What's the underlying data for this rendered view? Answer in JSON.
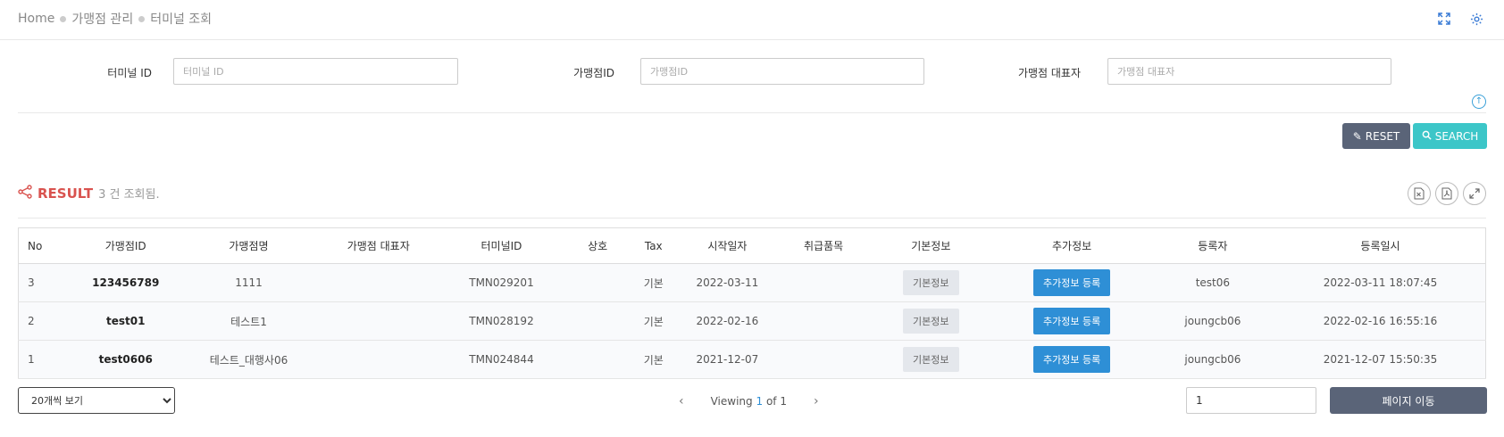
{
  "breadcrumb": [
    "Home",
    "가맹점 관리",
    "터미널 조회"
  ],
  "top_icons": [
    "fullscreen-icon",
    "gear-icon"
  ],
  "search": {
    "terminal_id": {
      "label": "터미널 ID",
      "placeholder": "터미널 ID",
      "value": ""
    },
    "merchant_id": {
      "label": "가맹점ID",
      "placeholder": "가맹점ID",
      "value": ""
    },
    "representative": {
      "label": "가맹점 대표자",
      "placeholder": "가맹점 대표자",
      "value": ""
    }
  },
  "buttons": {
    "reset": "RESET",
    "search": "SEARCH"
  },
  "result": {
    "title": "RESULT",
    "count_text": "3 건 조회됨."
  },
  "result_tools": [
    "excel-icon",
    "pdf-icon",
    "expand-icon"
  ],
  "table": {
    "headers": [
      "No",
      "가맹점ID",
      "가맹점명",
      "가맹점 대표자",
      "터미널ID",
      "상호",
      "Tax",
      "시작일자",
      "취급품목",
      "기본정보",
      "추가정보",
      "등록자",
      "등록일시"
    ],
    "rows": [
      {
        "no": "3",
        "merchant_id": "123456789",
        "merchant_name": "1111",
        "representative": "",
        "terminal_id": "TMN029201",
        "company": "",
        "tax": "기본",
        "start_date": "2022-03-11",
        "items": "",
        "basic_info": "기본정보",
        "extra_info": "추가정보 등록",
        "registrant": "test06",
        "registered_at": "2022-03-11 18:07:45"
      },
      {
        "no": "2",
        "merchant_id": "test01",
        "merchant_name": "테스트1",
        "representative": "",
        "terminal_id": "TMN028192",
        "company": "",
        "tax": "기본",
        "start_date": "2022-02-16",
        "items": "",
        "basic_info": "기본정보",
        "extra_info": "추가정보 등록",
        "registrant": "joungcb06",
        "registered_at": "2022-02-16 16:55:16"
      },
      {
        "no": "1",
        "merchant_id": "test0606",
        "merchant_name": "테스트_대행사06",
        "representative": "",
        "terminal_id": "TMN024844",
        "company": "",
        "tax": "기본",
        "start_date": "2021-12-07",
        "items": "",
        "basic_info": "기본정보",
        "extra_info": "추가정보 등록",
        "registrant": "joungcb06",
        "registered_at": "2021-12-07 15:50:35"
      }
    ]
  },
  "pagination": {
    "page_size_option": "20개씩 보기",
    "viewing_prefix": "Viewing",
    "current_page": "1",
    "of_text": "of 1",
    "page_input_value": "1",
    "goto_label": "페이지 이동"
  },
  "colors": {
    "reset": "#5a6478",
    "search": "#3cc6c8",
    "result": "#d9534f",
    "extra_btn": "#2e8fd6"
  }
}
